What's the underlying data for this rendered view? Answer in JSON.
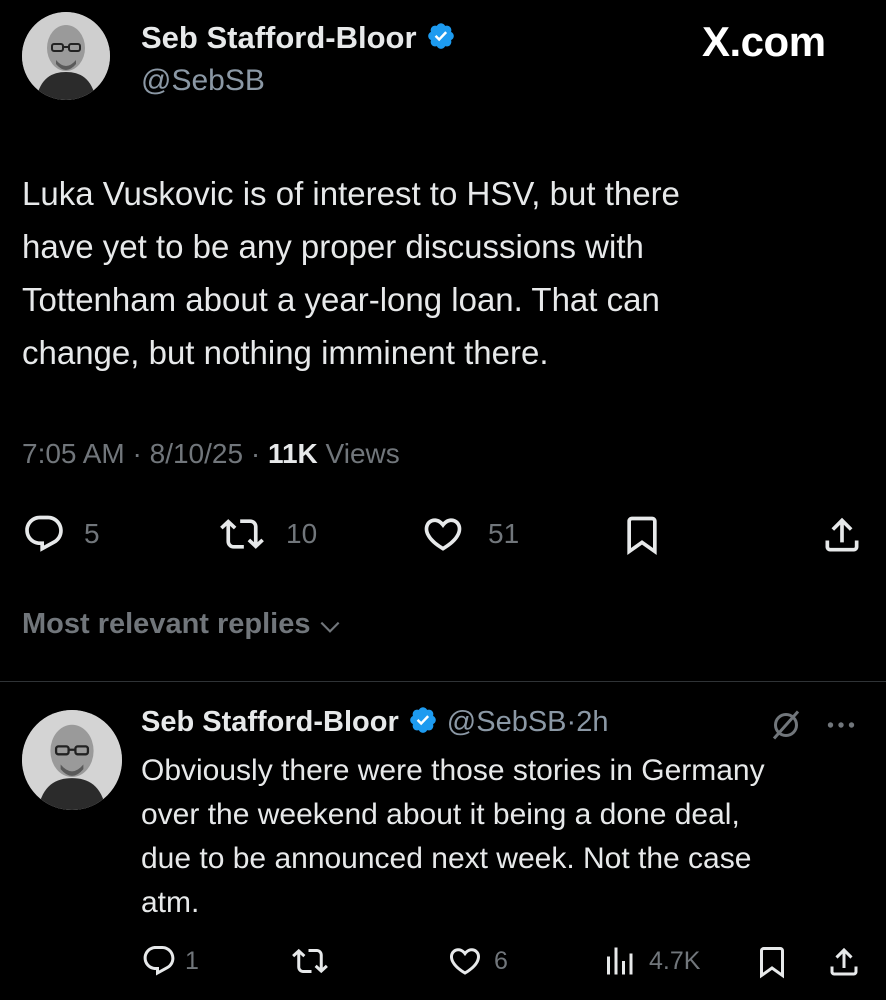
{
  "post": {
    "author_name": "Seb Stafford-Bloor",
    "author_handle": "@SebSB",
    "brand": "X.com",
    "text_lines": [
      "Luka Vuskovic is of interest to HSV, but there",
      "have yet to be any proper discussions with",
      "Tottenham about a year-long loan. That can",
      "change, but nothing imminent there."
    ],
    "time": "7:05 AM",
    "date": "8/10/25",
    "views_count": "11K",
    "views_label": "Views",
    "replies": "5",
    "reposts": "10",
    "likes": "51"
  },
  "sort": {
    "label": "Most relevant replies"
  },
  "reply": {
    "author_name": "Seb Stafford-Bloor",
    "author_handle": "@SebSB",
    "age": "2h",
    "text_lines": [
      "Obviously there were those stories in Germany",
      "over the weekend about it being a done deal,",
      "due to be announced next week. Not the case",
      "atm."
    ],
    "replies": "1",
    "reposts": "",
    "likes": "6",
    "views": "4.7K"
  },
  "colors": {
    "background": "#000000",
    "text": "#e7e9ea",
    "muted": "#71767b",
    "verified": "#1d9bf0",
    "divider": "#2f3336"
  }
}
